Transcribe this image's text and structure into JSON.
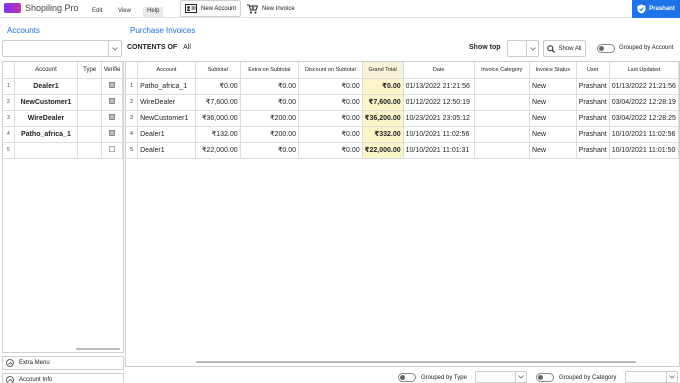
{
  "app": {
    "title": "Shopiling Pro"
  },
  "menu": [
    {
      "label": "Edit",
      "active": false
    },
    {
      "label": "View",
      "active": false
    },
    {
      "label": "Help",
      "active": true
    }
  ],
  "toolbar": {
    "new_account_label": "New Account",
    "new_invoice_label": "New Invoice"
  },
  "user": {
    "name": "Prashant"
  },
  "accounts_panel": {
    "title": "Accounts",
    "filter_value": "",
    "columns": [
      "Account",
      "Type",
      "Verifie"
    ],
    "rows": [
      {
        "num": "1",
        "account": "Dealer1",
        "type": "",
        "verified": true
      },
      {
        "num": "2",
        "account": "NewCustomer1",
        "type": "",
        "verified": true
      },
      {
        "num": "3",
        "account": "WireDealer",
        "type": "",
        "verified": true
      },
      {
        "num": "4",
        "account": "Patho_africa_1",
        "type": "",
        "verified": true
      },
      {
        "num": "5",
        "account": "",
        "type": "",
        "verified": false
      }
    ],
    "footer_extra_menu": "Extra Menu",
    "footer_account_info": "Account Info"
  },
  "invoices_panel": {
    "title": "Purchase Invoices",
    "contents_label": "CONTENTS OF",
    "contents_value": "All",
    "show_top_label": "Show top",
    "show_top_value": "",
    "show_all_label": "Show All",
    "grouped_by_account_label": "Grouped by Account",
    "grouped_by_type_label": "Grouped by Type",
    "grouped_by_category_label": "Grouped by Category",
    "columns": [
      "Account",
      "Subtotal",
      "Extra on Subtotal",
      "Discount on Subtotal",
      "Grand Total",
      "Date",
      "Invoice Category",
      "Invoice Status",
      "User",
      "Last Updated"
    ],
    "rows": [
      {
        "num": "1",
        "account": "Patho_africa_1",
        "subtotal": "₹0.00",
        "extra": "₹0.00",
        "discount": "₹0.00",
        "grand_total": "₹0.00",
        "date": "01/13/2022 21:21:56",
        "category": "",
        "status": "New",
        "user": "Prashant",
        "last_updated": "01/13/2022 21:21:56"
      },
      {
        "num": "2",
        "account": "WireDealer",
        "subtotal": "₹7,600.00",
        "extra": "₹0.00",
        "discount": "₹0.00",
        "grand_total": "₹7,600.00",
        "date": "01/12/2022 12:50:19",
        "category": "",
        "status": "New",
        "user": "Prashant",
        "last_updated": "03/04/2022 12:28:19"
      },
      {
        "num": "3",
        "account": "NewCustomer1",
        "subtotal": "₹36,000.00",
        "extra": "₹200.00",
        "discount": "₹0.00",
        "grand_total": "₹36,200.00",
        "date": "10/23/2021 23:05:12",
        "category": "",
        "status": "New",
        "user": "Prashant",
        "last_updated": "03/04/2022 12:28:25"
      },
      {
        "num": "4",
        "account": "Dealer1",
        "subtotal": "₹132.00",
        "extra": "₹200.00",
        "discount": "₹0.00",
        "grand_total": "₹332.00",
        "date": "10/10/2021 11:02:56",
        "category": "",
        "status": "New",
        "user": "Prashant",
        "last_updated": "10/10/2021 11:02:56"
      },
      {
        "num": "5",
        "account": "Dealer1",
        "subtotal": "₹22,000.00",
        "extra": "₹0.00",
        "discount": "₹0.00",
        "grand_total": "₹22,000.00",
        "date": "10/10/2021 11:01:31",
        "category": "",
        "status": "New",
        "user": "Prashant",
        "last_updated": "10/10/2021 11:01:50"
      }
    ]
  },
  "colors": {
    "accent": "#1e73e8",
    "grand_total_bg": "#fbf6c9",
    "logo_gradient_start": "#7b2ff7",
    "logo_gradient_end": "#c13aa0"
  }
}
